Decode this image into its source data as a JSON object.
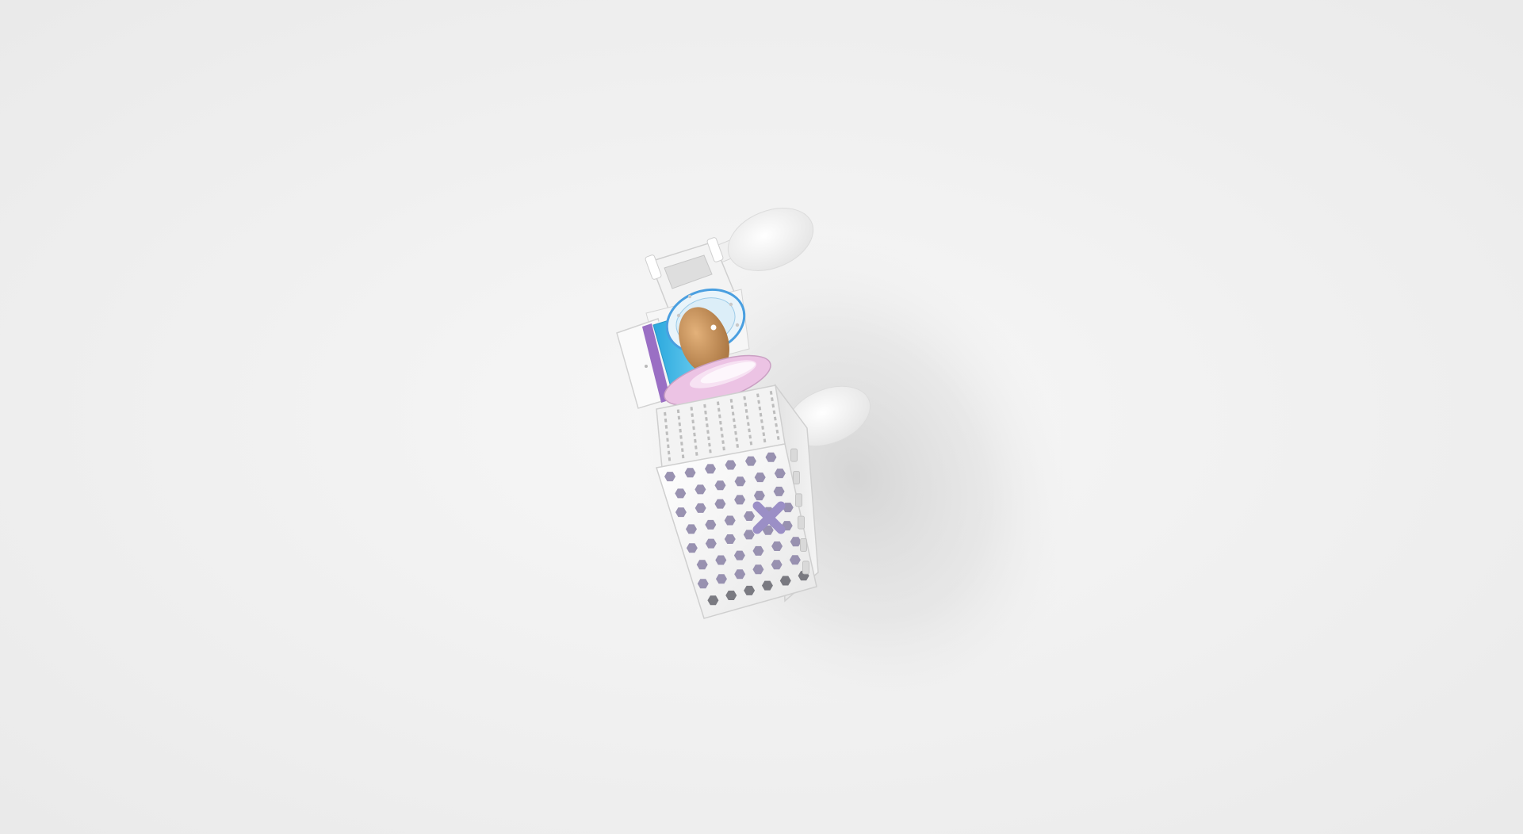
{
  "scene": {
    "subject": "",
    "background_color": "#ececec",
    "shadow_color": "#c9c9c9",
    "colors": {
      "body_white": "#f7f7f7",
      "body_edge": "#d8d8d8",
      "hex_hole_purple": "#8e86a8",
      "hex_hole_dark": "#6d6d74",
      "accent_cyan": "#3bb8e6",
      "accent_blue": "#4a9fe0",
      "accent_purple": "#9a6fc4",
      "ring_pink": "#e6b8de",
      "dome_tan": "#c9935b",
      "x_mark_purple": "#9b8fc6"
    },
    "icons": {
      "satellite": "satellite-render"
    }
  }
}
